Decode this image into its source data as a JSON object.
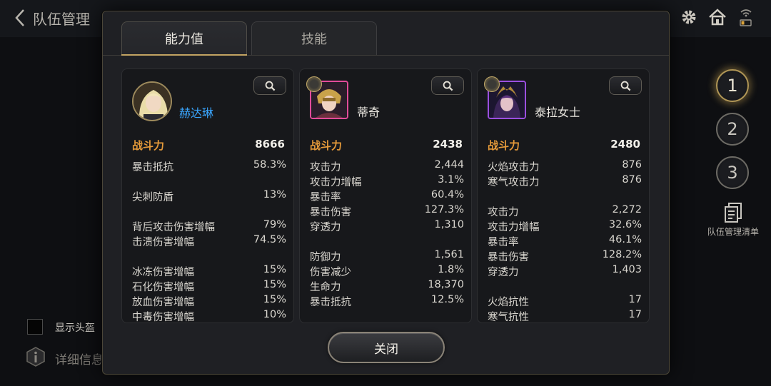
{
  "background": {
    "title": "队伍管理",
    "team_buttons": [
      "1",
      "2",
      "3"
    ],
    "team_list_label": "队伍管理清单",
    "show_helmet_label": "显示头盔",
    "details_label": "详细信息"
  },
  "modal": {
    "tabs": [
      {
        "label": "能力值",
        "active": true
      },
      {
        "label": "技能",
        "active": false
      }
    ],
    "close_label": "关闭",
    "cards": [
      {
        "name": "赫达琳",
        "name_color": "#3aa6ff",
        "power_label": "战斗力",
        "power": "8666",
        "stats": [
          {
            "label": "暴击抵抗",
            "value": "58.3%"
          },
          {
            "label": "尖刺防盾",
            "value": "13%"
          },
          {
            "label": "背后攻击伤害增幅",
            "value": "79%"
          },
          {
            "label": "击溃伤害增幅",
            "value": "74.5%"
          },
          {
            "label": "冰冻伤害增幅",
            "value": "15%"
          },
          {
            "label": "石化伤害增幅",
            "value": "15%"
          },
          {
            "label": "放血伤害增幅",
            "value": "15%"
          },
          {
            "label": "中毒伤害增幅",
            "value": "10%"
          }
        ]
      },
      {
        "name": "蒂奇",
        "power_label": "战斗力",
        "power": "2438",
        "stats": [
          {
            "label": "攻击力",
            "value": "2,444"
          },
          {
            "label": "攻击力增幅",
            "value": "3.1%"
          },
          {
            "label": "暴击率",
            "value": "60.4%"
          },
          {
            "label": "暴击伤害",
            "value": "127.3%"
          },
          {
            "label": "穿透力",
            "value": "1,310"
          },
          {
            "label": "防御力",
            "value": "1,561"
          },
          {
            "label": "伤害减少",
            "value": "1.8%"
          },
          {
            "label": "生命力",
            "value": "18,370"
          },
          {
            "label": "暴击抵抗",
            "value": "12.5%"
          }
        ]
      },
      {
        "name": "泰拉女士",
        "power_label": "战斗力",
        "power": "2480",
        "stats": [
          {
            "label": "火焰攻击力",
            "value": "876"
          },
          {
            "label": "寒气攻击力",
            "value": "876"
          },
          {
            "label": "攻击力",
            "value": "2,272"
          },
          {
            "label": "攻击力增幅",
            "value": "32.6%"
          },
          {
            "label": "暴击率",
            "value": "46.1%"
          },
          {
            "label": "暴击伤害",
            "value": "128.2%"
          },
          {
            "label": "穿透力",
            "value": "1,403"
          },
          {
            "label": "火焰抗性",
            "value": "17"
          },
          {
            "label": "寒气抗性",
            "value": "17"
          }
        ]
      }
    ]
  }
}
